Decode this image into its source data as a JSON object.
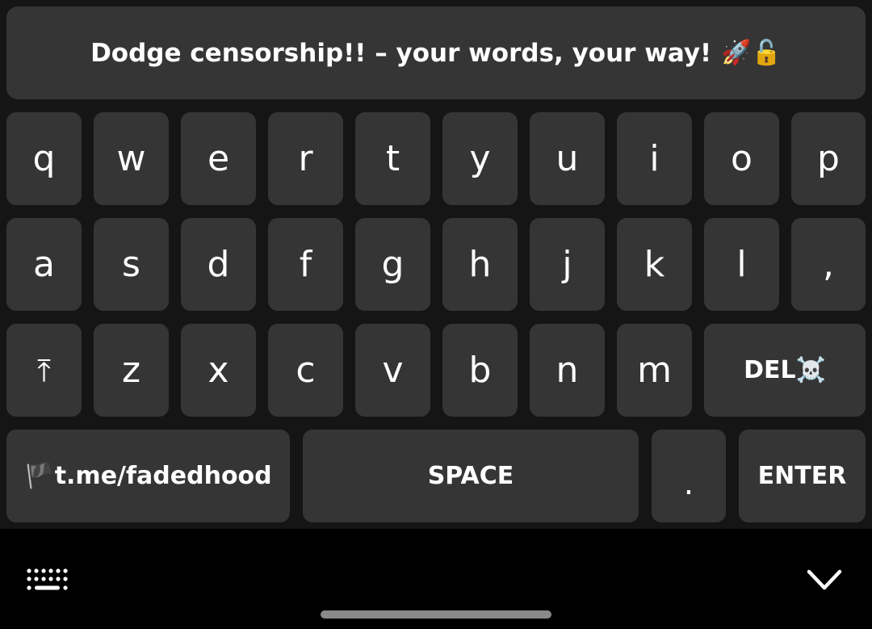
{
  "banner": {
    "text": "Dodge censorship!! – your words, your way!",
    "emoji": "🚀🔓"
  },
  "rows": {
    "row1": [
      "q",
      "w",
      "e",
      "r",
      "t",
      "y",
      "u",
      "i",
      "o",
      "p"
    ],
    "row2": [
      "a",
      "s",
      "d",
      "f",
      "g",
      "h",
      "j",
      "k",
      "l",
      ","
    ],
    "row3": [
      "z",
      "x",
      "c",
      "v",
      "b",
      "n",
      "m"
    ]
  },
  "keys": {
    "shift": "⤒",
    "del": "DEL☠️",
    "link": "🏴t.me/fadedhood",
    "space": "SPACE",
    "period": ".",
    "enter": "ENTER"
  },
  "nav": {
    "keyboard_switch_icon": "keyboard-icon",
    "hide_keyboard_icon": "chevron-down-icon"
  },
  "colors": {
    "key_bg": "#353535",
    "keyboard_bg": "#151515",
    "text": "#ffffff"
  }
}
